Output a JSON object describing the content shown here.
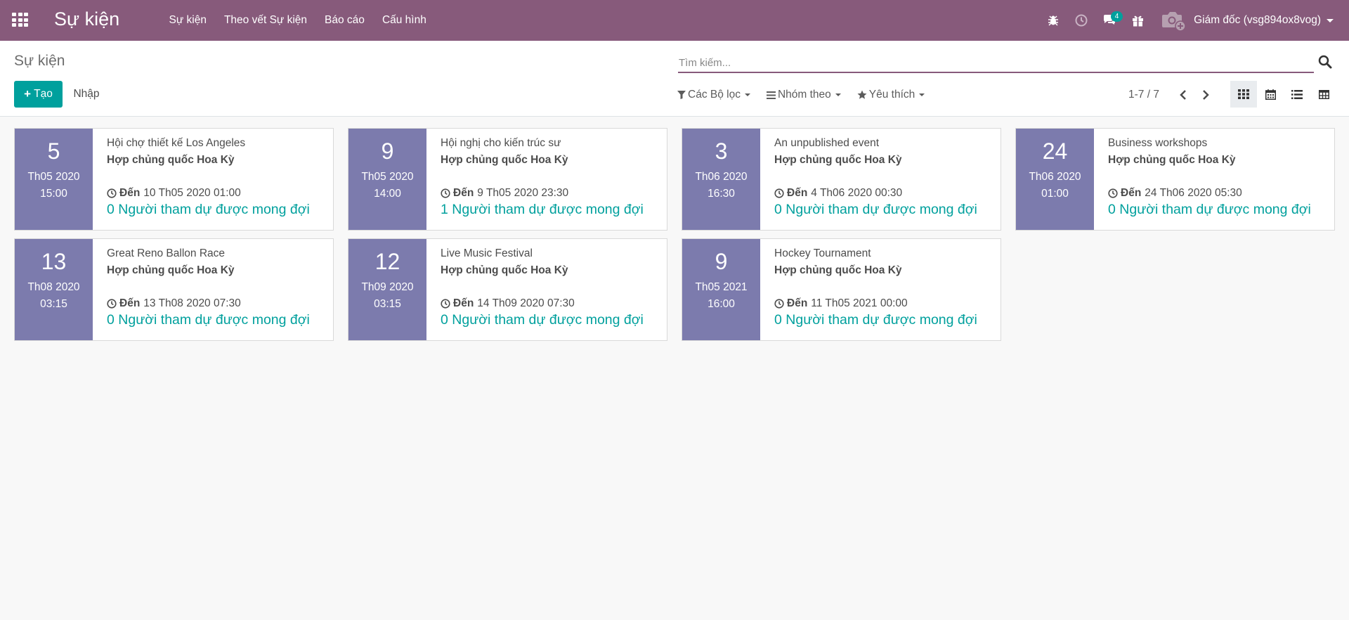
{
  "navbar": {
    "app_title": "Sự kiện",
    "menu": [
      "Sự kiện",
      "Theo vết Sự kiện",
      "Báo cáo",
      "Cấu hình"
    ],
    "messages_badge": "4",
    "user_name": "Giám đốc (vsg894ox8vog)",
    "color": "#875a7b"
  },
  "control_panel": {
    "breadcrumb": "Sự kiện",
    "create_label": "Tạo",
    "import_label": "Nhập",
    "search_placeholder": "Tìm kiếm...",
    "filters_label": "Các Bộ lọc",
    "groupby_label": "Nhóm theo",
    "favorites_label": "Yêu thích",
    "pager_value": "1-7 / 7",
    "views": [
      "kanban-view",
      "calendar-view",
      "list-view",
      "pivot-view"
    ],
    "active_view": "kanban-view"
  },
  "events": [
    {
      "day": "5",
      "month_year": "Th05 2020",
      "time": "15:00",
      "name": "Hội chợ thiết kế Los Angeles",
      "country": "Hợp chủng quốc Hoa Kỳ",
      "end_label": "Đến",
      "end": "10 Th05 2020 01:00",
      "attendees": "0 Người tham dự được mong đợi"
    },
    {
      "day": "9",
      "month_year": "Th05 2020",
      "time": "14:00",
      "name": "Hội nghị cho kiến trúc sư",
      "country": "Hợp chủng quốc Hoa Kỳ",
      "end_label": "Đến",
      "end": "9 Th05 2020 23:30",
      "attendees": "1 Người tham dự được mong đợi"
    },
    {
      "day": "3",
      "month_year": "Th06 2020",
      "time": "16:30",
      "name": "An unpublished event",
      "country": "Hợp chủng quốc Hoa Kỳ",
      "end_label": "Đến",
      "end": "4 Th06 2020 00:30",
      "attendees": "0 Người tham dự được mong đợi"
    },
    {
      "day": "24",
      "month_year": "Th06 2020",
      "time": "01:00",
      "name": "Business workshops",
      "country": "Hợp chủng quốc Hoa Kỳ",
      "end_label": "Đến",
      "end": "24 Th06 2020 05:30",
      "attendees": "0 Người tham dự được mong đợi"
    },
    {
      "day": "13",
      "month_year": "Th08 2020",
      "time": "03:15",
      "name": "Great Reno Ballon Race",
      "country": "Hợp chủng quốc Hoa Kỳ",
      "end_label": "Đến",
      "end": "13 Th08 2020 07:30",
      "attendees": "0 Người tham dự được mong đợi"
    },
    {
      "day": "12",
      "month_year": "Th09 2020",
      "time": "03:15",
      "name": "Live Music Festival",
      "country": "Hợp chủng quốc Hoa Kỳ",
      "end_label": "Đến",
      "end": "14 Th09 2020 07:30",
      "attendees": "0 Người tham dự được mong đợi"
    },
    {
      "day": "9",
      "month_year": "Th05 2021",
      "time": "16:00",
      "name": "Hockey Tournament",
      "country": "Hợp chủng quốc Hoa Kỳ",
      "end_label": "Đến",
      "end": "11 Th05 2021 00:00",
      "attendees": "0 Người tham dự được mong đợi"
    }
  ],
  "colors": {
    "date_box": "#7c7bad",
    "accent": "#00a09d"
  }
}
